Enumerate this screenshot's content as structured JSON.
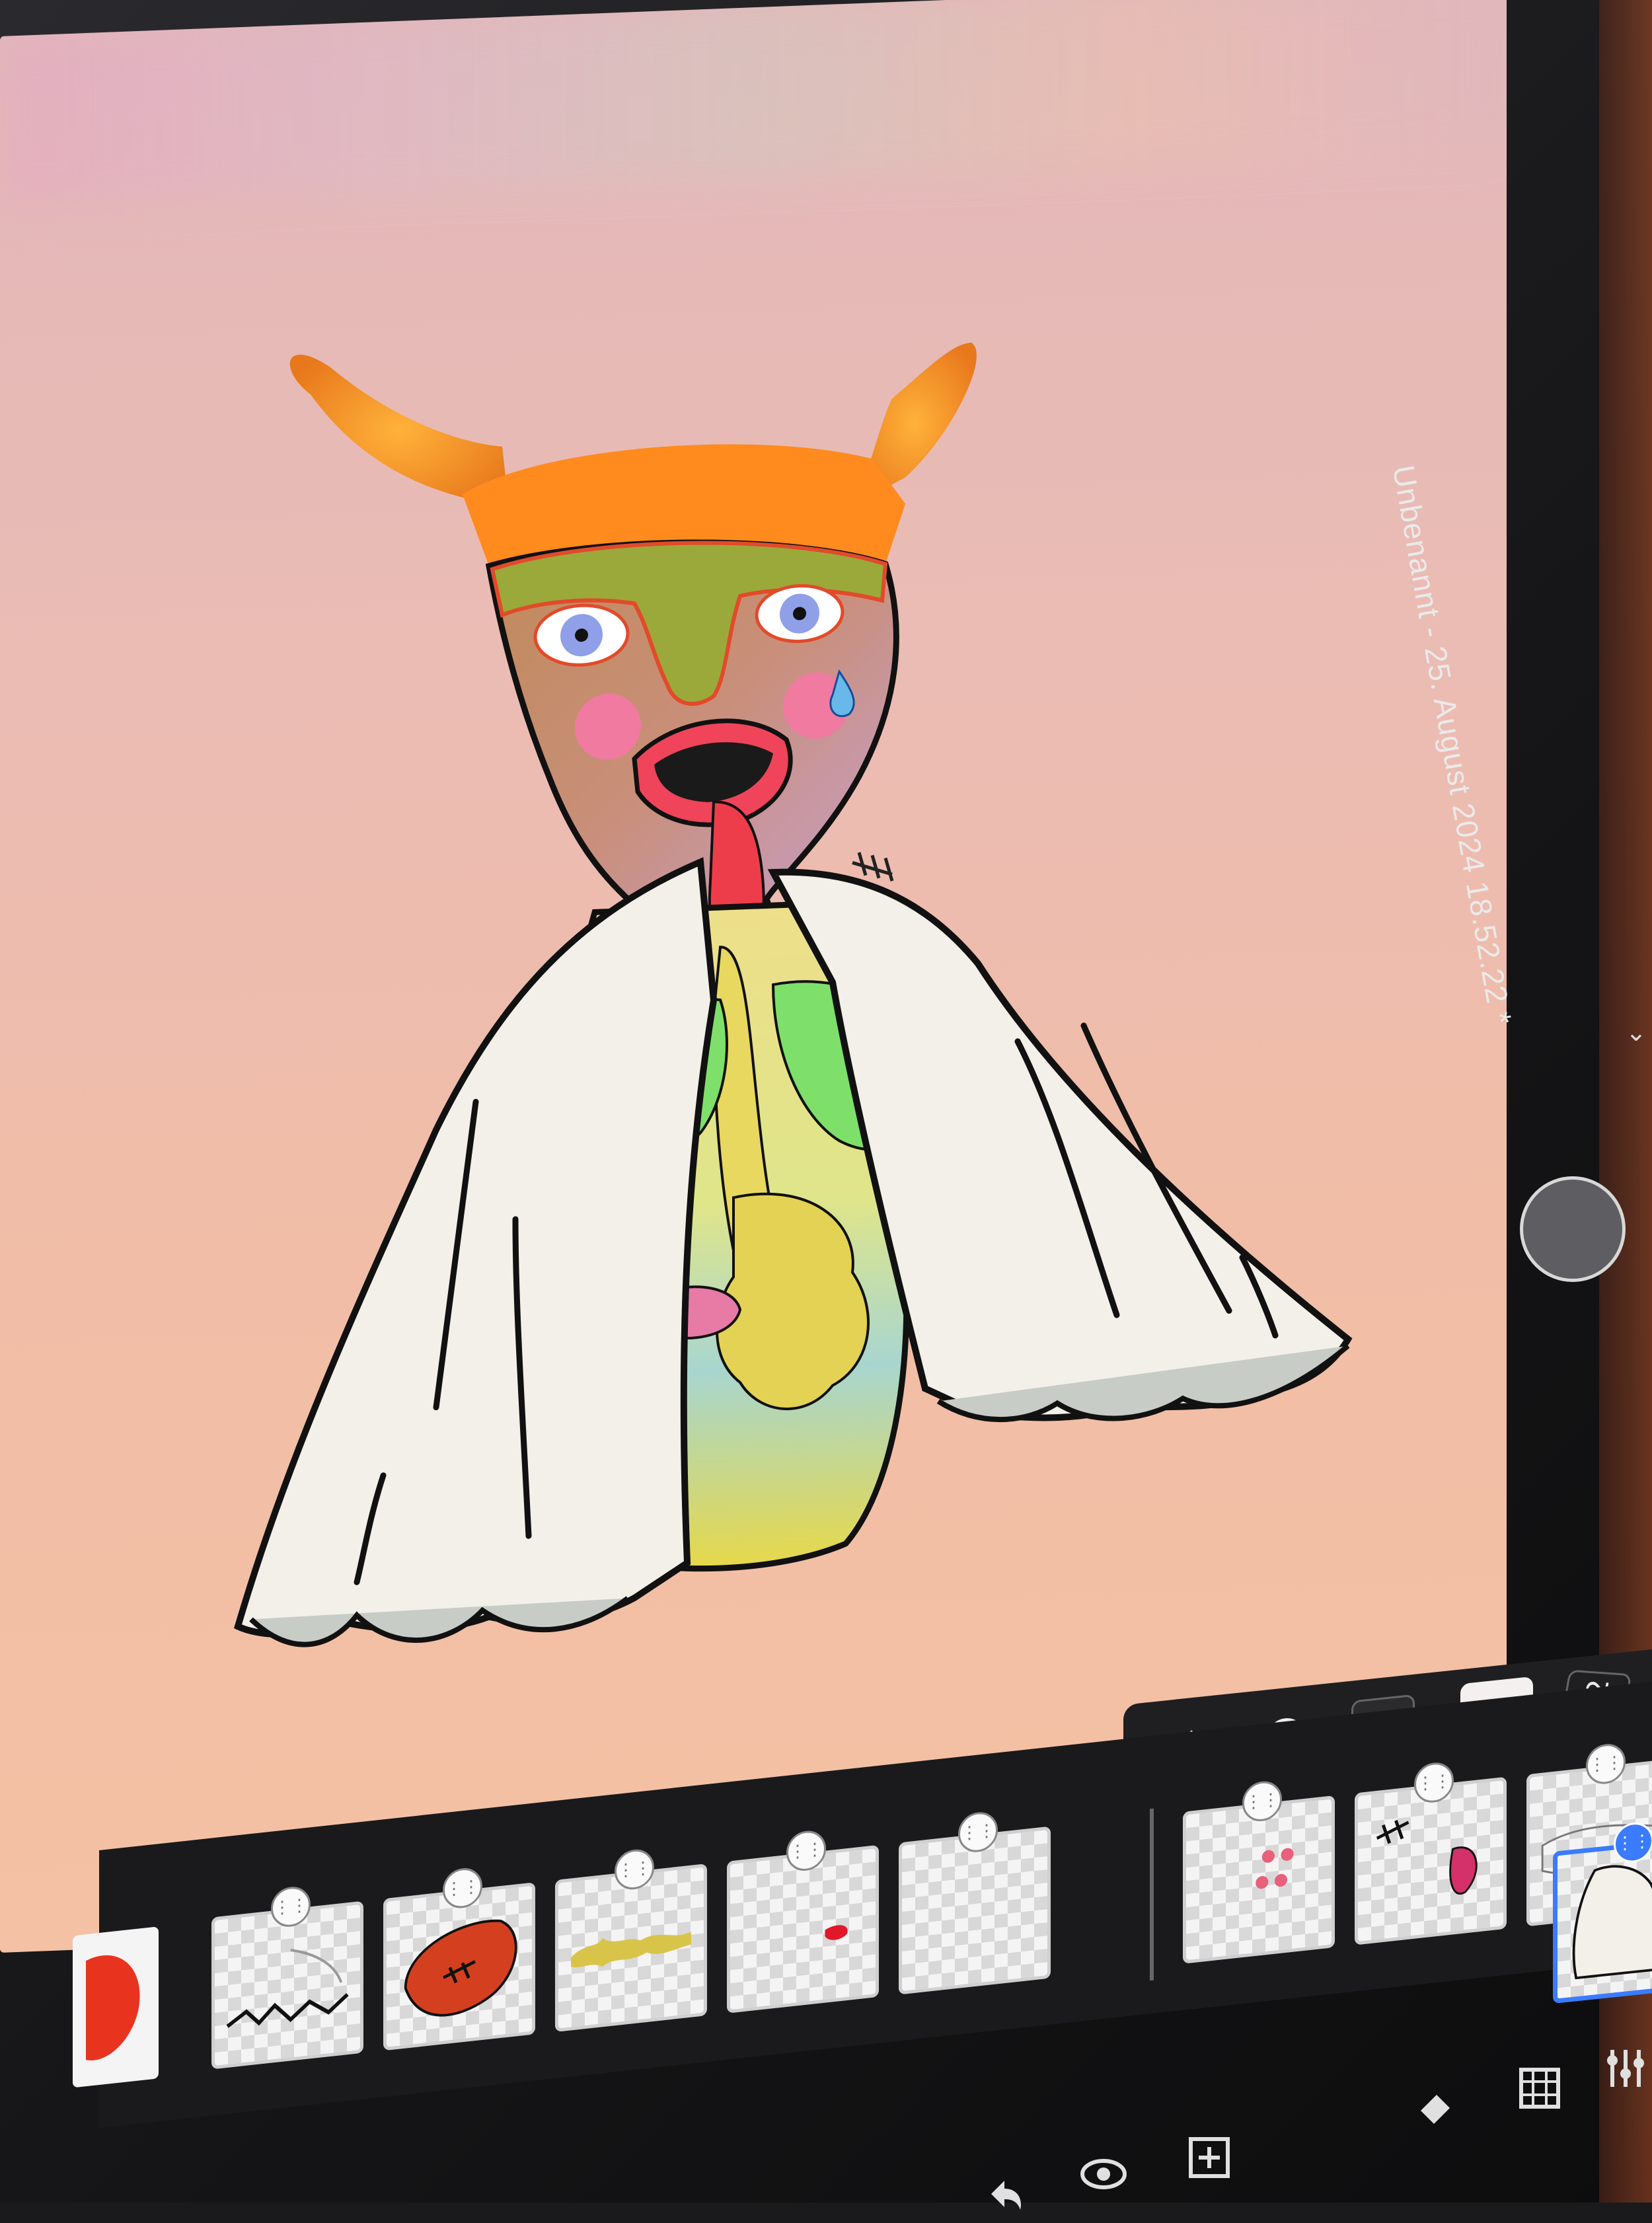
{
  "document": {
    "title": "Unbenannt - 25. August 2024 18.52.22 *"
  },
  "toolbar": {
    "brush_size": "172",
    "current_color": "#f3f0ef",
    "tools": [
      "adjustments-icon",
      "transform-icon",
      "stroke-icon"
    ]
  },
  "layers": {
    "thumbnails": [
      {
        "content": "red-shape"
      },
      {
        "content": "zigzag-lines"
      },
      {
        "content": "stitched-red-organ"
      },
      {
        "content": "yellow-squiggle"
      },
      {
        "content": "small-red-mark"
      },
      {
        "content": "empty"
      },
      {
        "content": "eyes-dots"
      },
      {
        "content": "stitch-and-pink-shape"
      },
      {
        "content": "body-outline"
      },
      {
        "content": "cape-outline",
        "selected": true
      }
    ]
  },
  "bottom_icons": [
    "undo-icon",
    "eye-icon",
    "add-layer-icon",
    "fill-icon",
    "grid-icon",
    "settings-icon"
  ],
  "colors": {
    "canvas_top": "#e2b7b9",
    "canvas_bottom": "#f4c1a4",
    "horn": "#f08a1c",
    "cape": "#f1ece6",
    "lungs": "#6ed35a",
    "tongue": "#ee3d4a",
    "selection": "#3a7bff"
  }
}
